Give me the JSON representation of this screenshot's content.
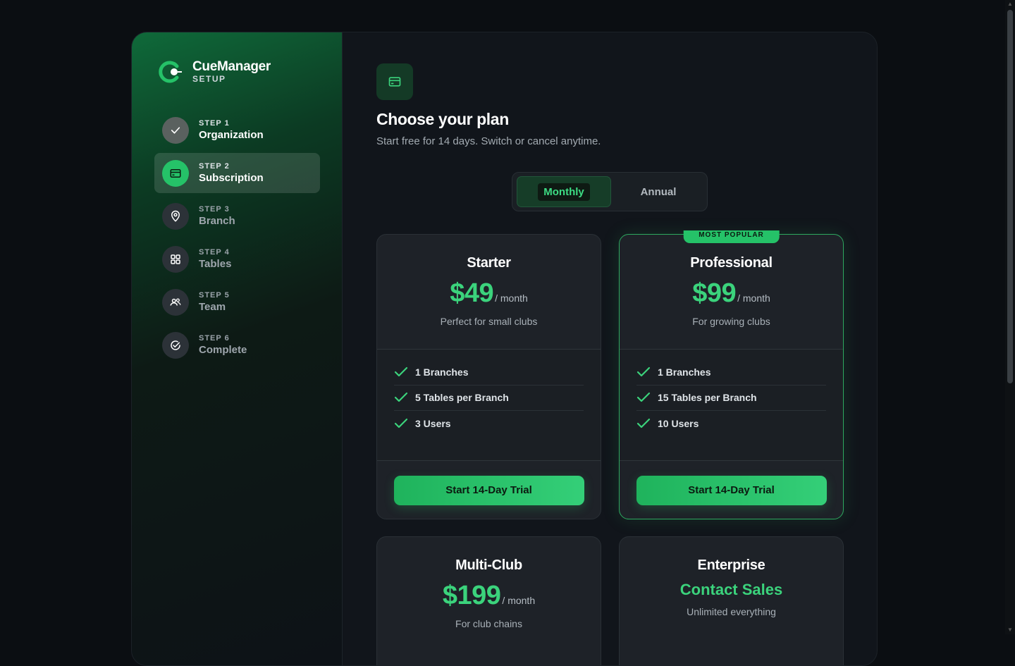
{
  "brand": {
    "name": "CueManager",
    "subtitle": "SETUP"
  },
  "steps": [
    {
      "num": "STEP 1",
      "label": "Organization",
      "icon": "check-icon",
      "state": "done"
    },
    {
      "num": "STEP 2",
      "label": "Subscription",
      "icon": "credit-card-icon",
      "state": "active"
    },
    {
      "num": "STEP 3",
      "label": "Branch",
      "icon": "map-pin-icon",
      "state": "pending"
    },
    {
      "num": "STEP 4",
      "label": "Tables",
      "icon": "grid-icon",
      "state": "pending"
    },
    {
      "num": "STEP 5",
      "label": "Team",
      "icon": "users-icon",
      "state": "pending"
    },
    {
      "num": "STEP 6",
      "label": "Complete",
      "icon": "check-circle-icon",
      "state": "pending"
    }
  ],
  "header": {
    "icon": "credit-card-icon",
    "title": "Choose your plan",
    "subtitle": "Start free for 14 days. Switch or cancel anytime."
  },
  "billing_toggle": {
    "monthly": "Monthly",
    "annual": "Annual",
    "selected": "Monthly"
  },
  "plans": [
    {
      "name": "Starter",
      "price": "$49",
      "period": "/ month",
      "desc": "Perfect for small clubs",
      "features": [
        "1 Branches",
        "5 Tables per Branch",
        "3 Users"
      ],
      "cta": "Start 14-Day Trial"
    },
    {
      "name": "Professional",
      "price": "$99",
      "period": "/ month",
      "desc": "For growing clubs",
      "badge": "MOST POPULAR",
      "features": [
        "1 Branches",
        "15 Tables per Branch",
        "10 Users"
      ],
      "cta": "Start 14-Day Trial"
    },
    {
      "name": "Multi-Club",
      "price": "$199",
      "period": "/ month",
      "desc": "For club chains"
    },
    {
      "name": "Enterprise",
      "contact": "Contact Sales",
      "desc": "Unlimited everything"
    }
  ],
  "colors": {
    "accent": "#25c268",
    "price": "#3bd37c",
    "background": "#0b0e12",
    "card": "#1e2228"
  }
}
